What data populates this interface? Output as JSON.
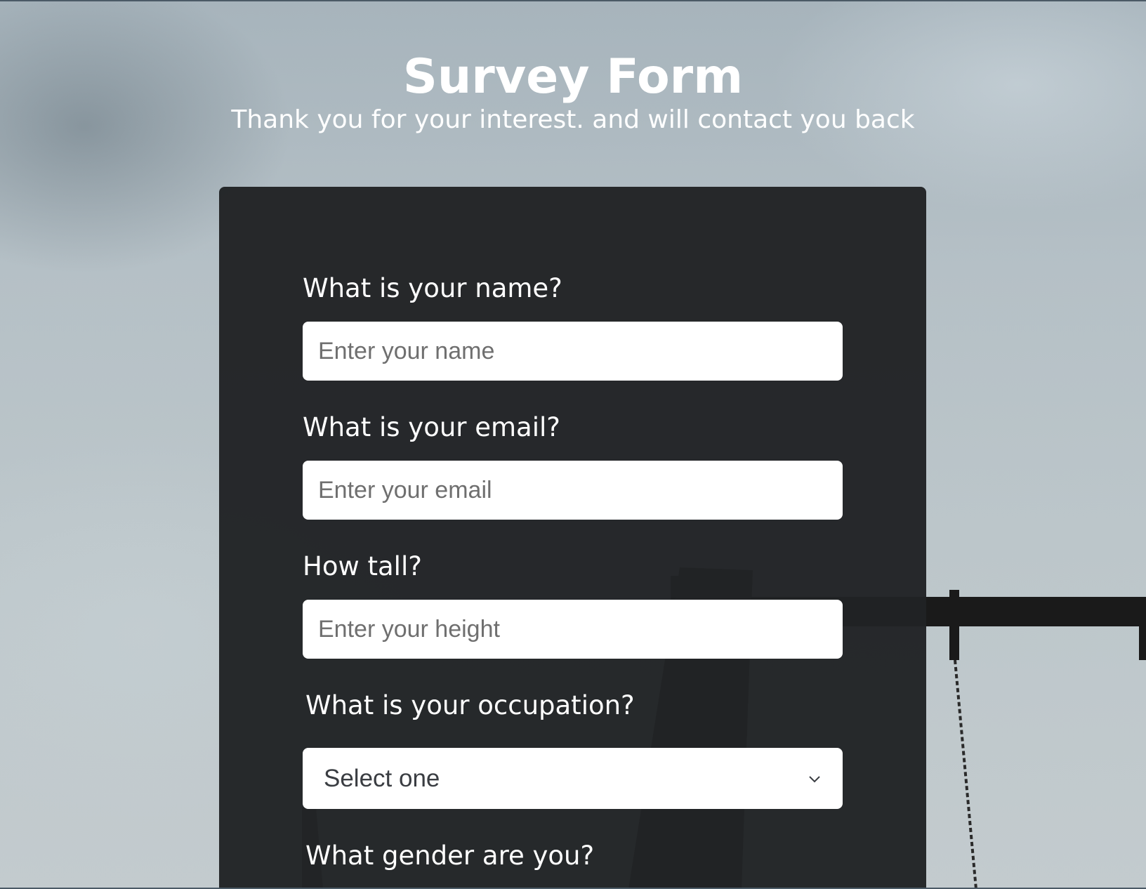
{
  "header": {
    "title": "Survey Form",
    "subtitle": "Thank you for your interest. and will contact you back"
  },
  "form": {
    "name_field": {
      "label": "What is your name?",
      "placeholder": "Enter your name"
    },
    "email_field": {
      "label": "What is your email?",
      "placeholder": "Enter your email"
    },
    "height_field": {
      "label": "How tall?",
      "placeholder": "Enter your height"
    },
    "occupation_field": {
      "label": "What is your occupation?",
      "selected": "Select one",
      "icon": "chevron-down-icon"
    },
    "gender_field": {
      "label": "What gender are you?"
    }
  },
  "colors": {
    "card_background": "#212325",
    "text": "#ffffff",
    "input_background": "#ffffff",
    "placeholder": "#6f6f6f"
  }
}
